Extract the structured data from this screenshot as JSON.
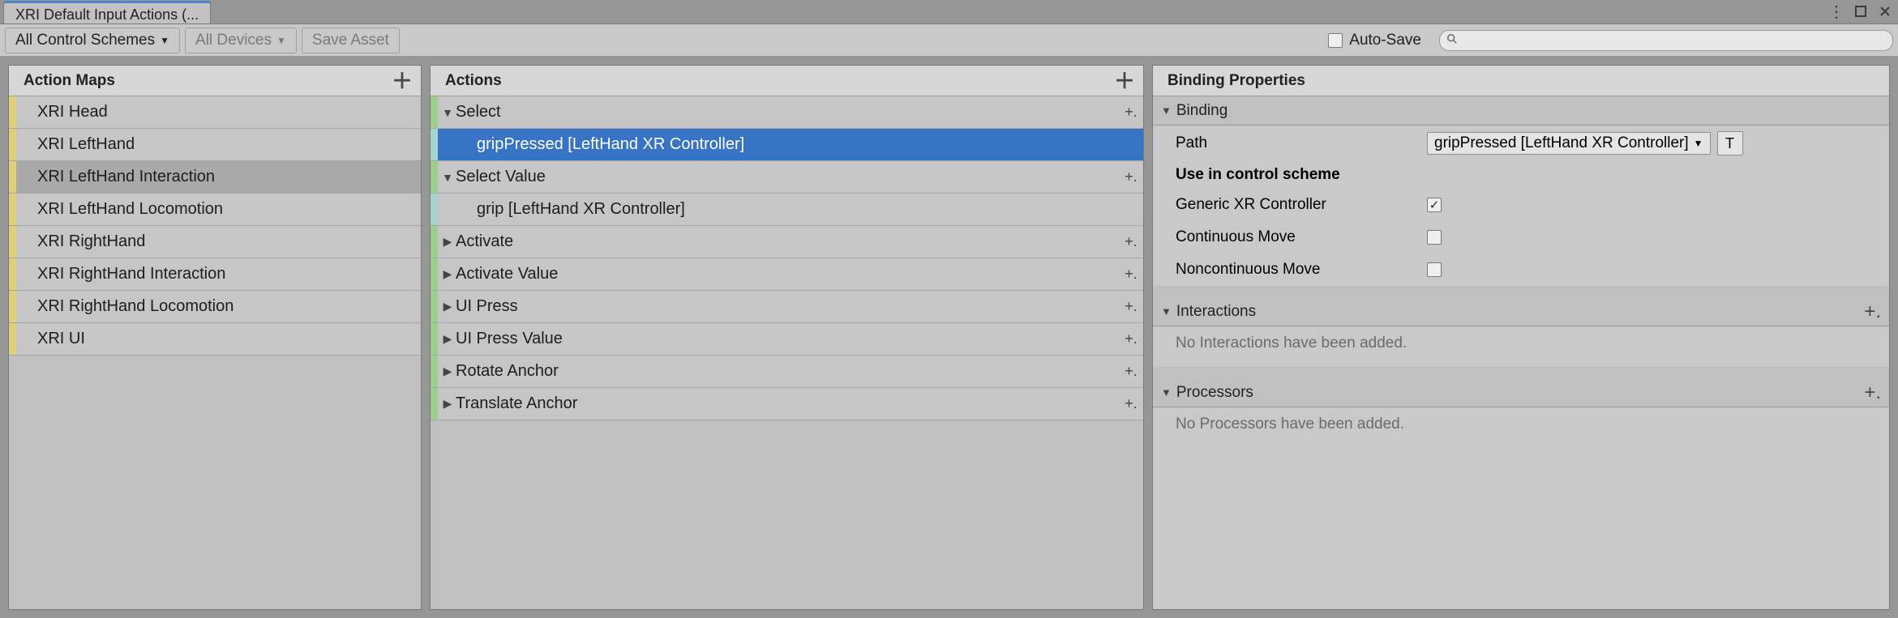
{
  "tab": {
    "title": "XRI Default Input Actions (..."
  },
  "toolbar": {
    "schemes_label": "All Control Schemes",
    "devices_label": "All Devices",
    "save_label": "Save Asset",
    "autosave_label": "Auto-Save",
    "search_placeholder": ""
  },
  "panels": {
    "maps_title": "Action Maps",
    "actions_title": "Actions",
    "props_title": "Binding Properties"
  },
  "action_maps": [
    {
      "label": "XRI Head"
    },
    {
      "label": "XRI LeftHand"
    },
    {
      "label": "XRI LeftHand Interaction",
      "selected": true
    },
    {
      "label": "XRI LeftHand Locomotion"
    },
    {
      "label": "XRI RightHand"
    },
    {
      "label": "XRI RightHand Interaction"
    },
    {
      "label": "XRI RightHand Locomotion"
    },
    {
      "label": "XRI UI"
    }
  ],
  "actions": [
    {
      "label": "Select",
      "expanded": true
    },
    {
      "label": "gripPressed [LeftHand XR Controller]",
      "binding": true,
      "selected": true
    },
    {
      "label": "Select Value",
      "expanded": true
    },
    {
      "label": "grip [LeftHand XR Controller]",
      "binding": true
    },
    {
      "label": "Activate"
    },
    {
      "label": "Activate Value"
    },
    {
      "label": "UI Press"
    },
    {
      "label": "UI Press Value"
    },
    {
      "label": "Rotate Anchor"
    },
    {
      "label": "Translate Anchor"
    }
  ],
  "binding": {
    "section_label": "Binding",
    "path_label": "Path",
    "path_value": "gripPressed [LeftHand XR Controller]",
    "t_button": "T",
    "use_scheme_label": "Use in control scheme",
    "schemes": [
      {
        "label": "Generic XR Controller",
        "checked": true
      },
      {
        "label": "Continuous Move",
        "checked": false
      },
      {
        "label": "Noncontinuous Move",
        "checked": false
      }
    ]
  },
  "interactions": {
    "title": "Interactions",
    "empty": "No Interactions have been added."
  },
  "processors": {
    "title": "Processors",
    "empty": "No Processors have been added."
  }
}
